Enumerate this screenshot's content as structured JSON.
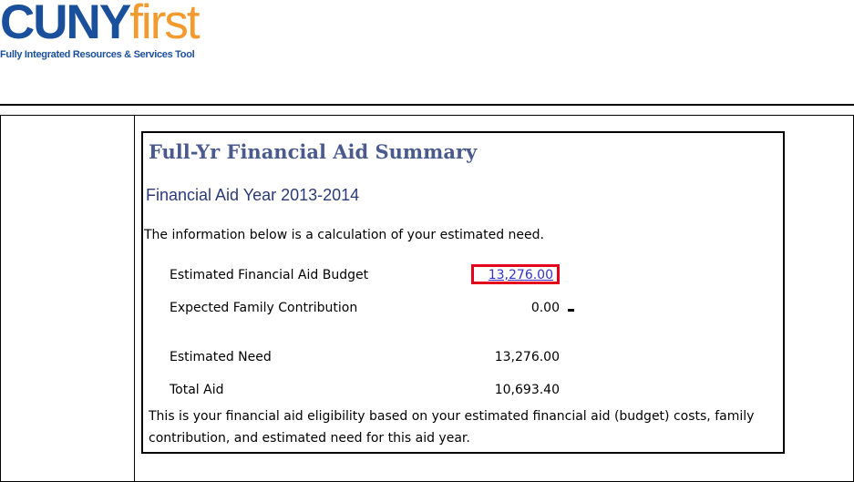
{
  "logo": {
    "brand_cuny": "CUNY",
    "brand_first": "first",
    "tagline": "Fully Integrated Resources & Services Tool"
  },
  "summary": {
    "title": "Full-Yr Financial Aid Summary",
    "aid_year": "Financial Aid Year 2013-2014",
    "intro": "The information below is a calculation of your estimated need.",
    "rows": [
      {
        "label": "Estimated Financial Aid Budget",
        "value": "13,276.00"
      },
      {
        "label": "Expected Family Contribution",
        "value": "0.00"
      },
      {
        "label": "Estimated Need",
        "value": "13,276.00"
      },
      {
        "label": "Total Aid",
        "value": "10,693.40"
      }
    ],
    "footnote": "This is your financial aid eligibility based on your estimated financial aid (budget) costs, family contribution, and estimated need for this aid year."
  },
  "colors": {
    "brand_blue": "#1a4f9c",
    "brand_orange": "#f29a2e",
    "link_blue": "#3333cc",
    "highlight_red": "#e3001b",
    "title_color": "#4a5a8c"
  }
}
